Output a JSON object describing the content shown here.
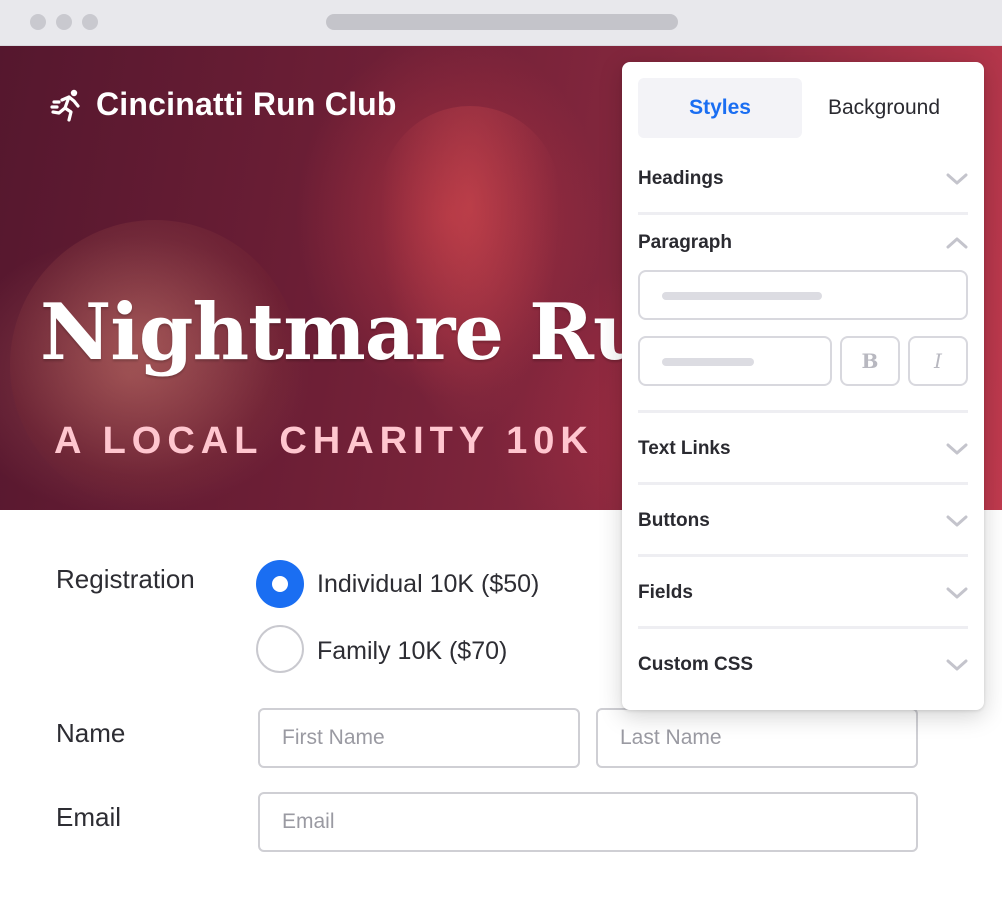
{
  "hero": {
    "club_name": "Cincinatti Run Club",
    "event_title": "Nightmare Run",
    "event_subtitle": "A LOCAL CHARITY 10K"
  },
  "form": {
    "registration_label": "Registration",
    "options": [
      {
        "label": "Individual 10K ($50)",
        "selected": true
      },
      {
        "label": "Family 10K ($70)",
        "selected": false
      }
    ],
    "name_label": "Name",
    "first_name_placeholder": "First Name",
    "last_name_placeholder": "Last Name",
    "email_label": "Email",
    "email_placeholder": "Email"
  },
  "panel": {
    "tabs": [
      {
        "label": "Styles",
        "active": true
      },
      {
        "label": "Background",
        "active": false
      }
    ],
    "sections": [
      {
        "label": "Headings",
        "expanded": false
      },
      {
        "label": "Paragraph",
        "expanded": true
      },
      {
        "label": "Text Links",
        "expanded": false
      },
      {
        "label": "Buttons",
        "expanded": false
      },
      {
        "label": "Fields",
        "expanded": false
      },
      {
        "label": "Custom CSS",
        "expanded": false
      }
    ],
    "bold_glyph": "B",
    "italic_glyph": "I"
  },
  "colors": {
    "accent": "#1a6ef2",
    "hero_subtitle": "#ffc6cf",
    "hero_dark": "#55172e",
    "hero_light": "#c03a4e"
  },
  "icons": {
    "brand": "runner-icon",
    "collapsed": "chevron-down-icon",
    "expanded": "chevron-up-icon"
  }
}
